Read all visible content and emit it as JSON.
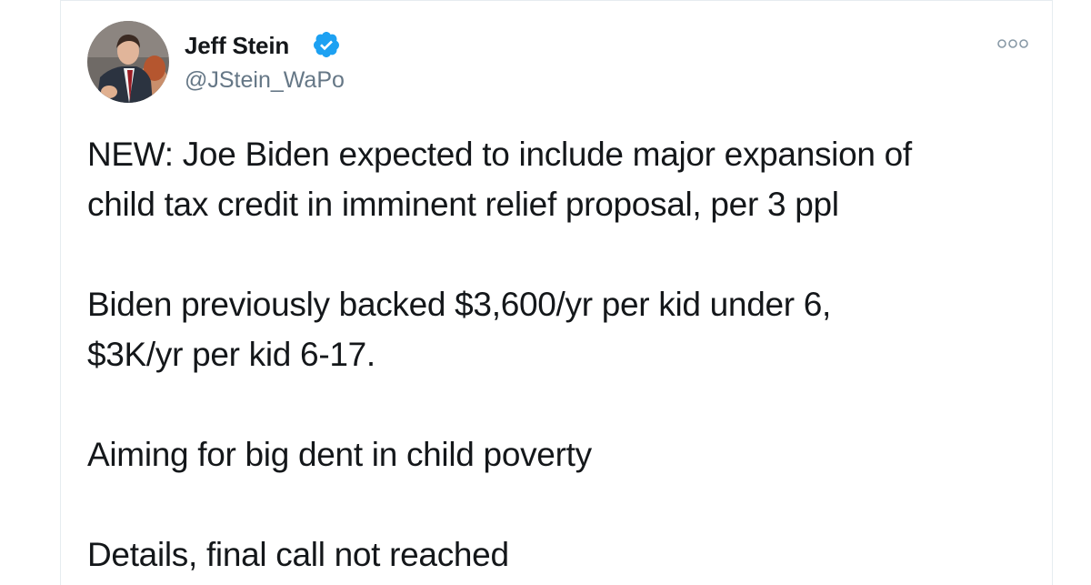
{
  "author": {
    "name": "Jeff Stein",
    "handle": "@JStein_WaPo",
    "verified": true
  },
  "icons": {
    "verified": "verified-badge-icon",
    "more": "more-options-icon",
    "avatar": "profile-photo"
  },
  "colors": {
    "text": "#14171a",
    "secondary": "#657786",
    "verified": "#1da1f2"
  },
  "tweet": {
    "paragraphs": [
      {
        "lines": [
          "NEW: Joe Biden expected to include major expansion of",
          "child tax credit in imminent relief proposal, per 3 ppl"
        ]
      },
      {
        "lines": [
          "Biden previously backed $3,600/yr per kid under 6,",
          "$3K/yr per kid 6-17."
        ]
      },
      {
        "lines": [
          "Aiming for big dent in child poverty"
        ]
      },
      {
        "lines": [
          "Details, final call not reached"
        ]
      }
    ]
  }
}
